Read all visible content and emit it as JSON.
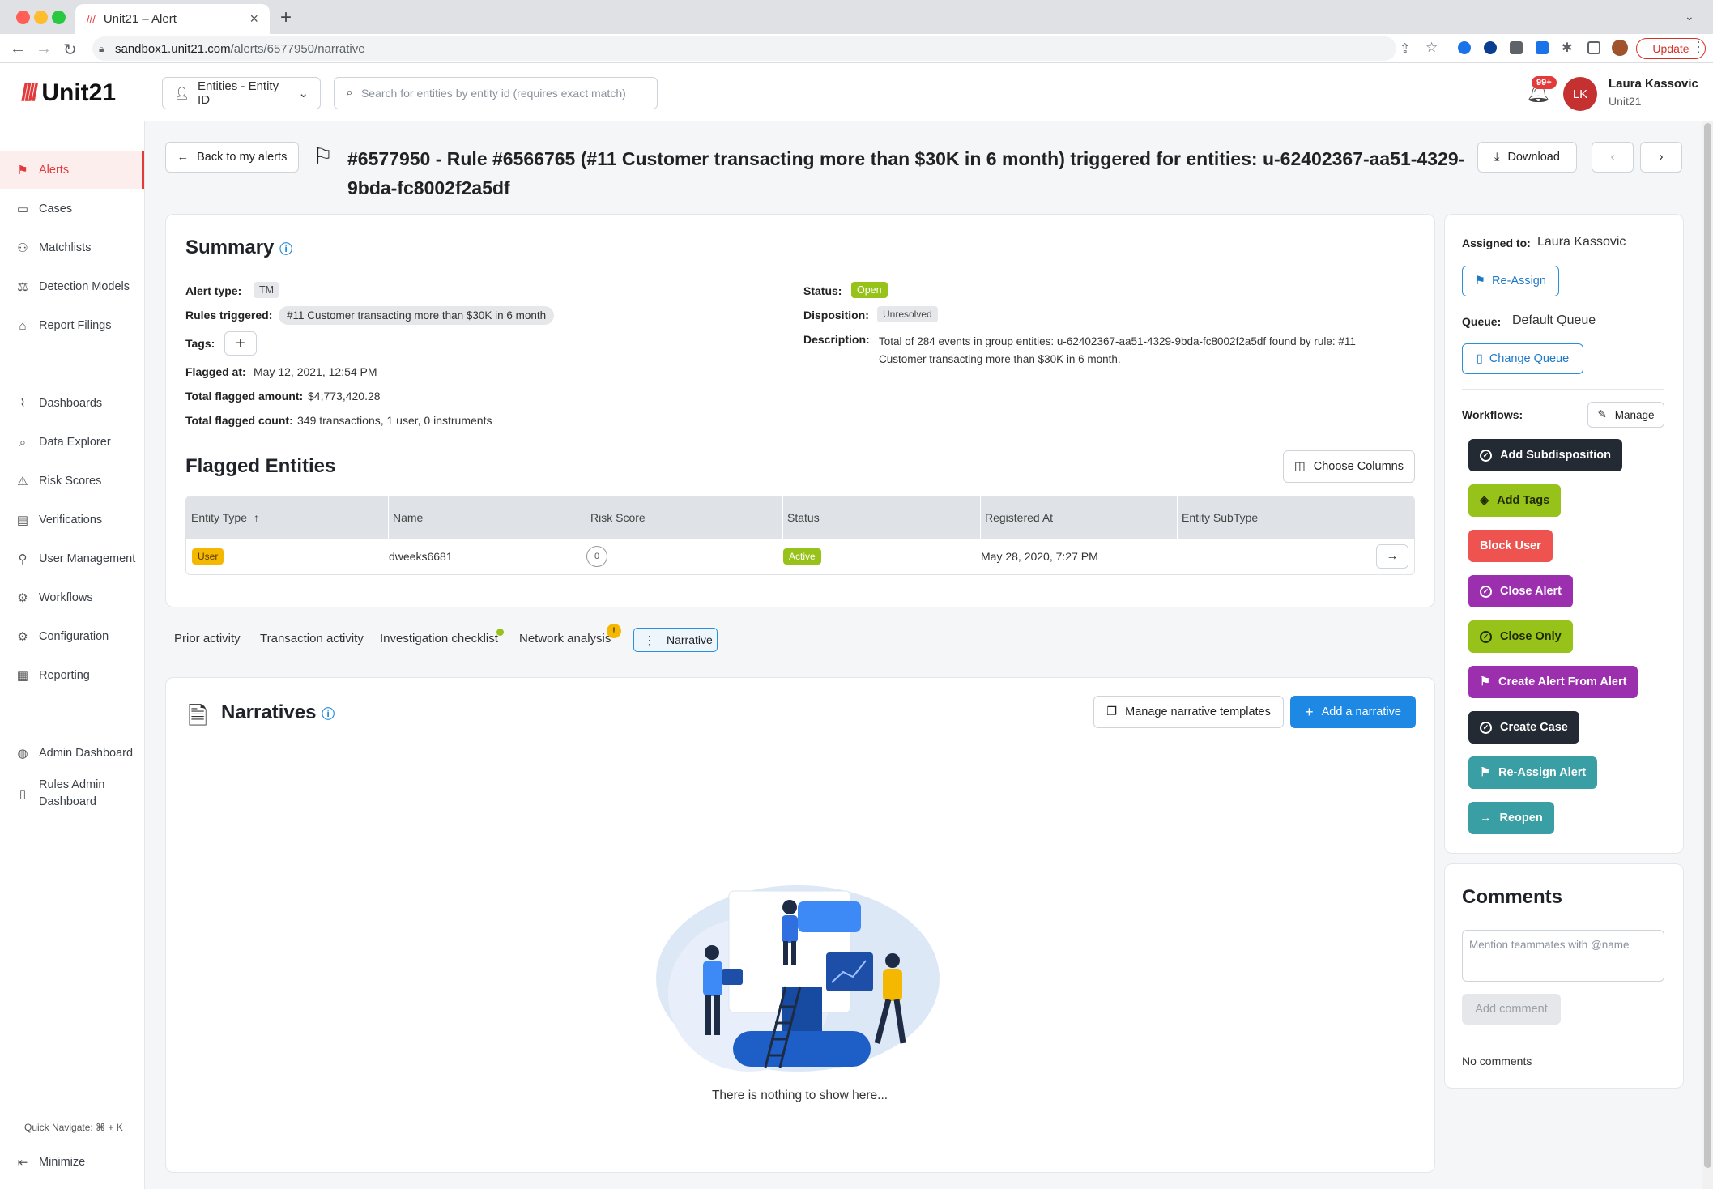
{
  "browser": {
    "tab_title": "Unit21 – Alert",
    "url_host": "sandbox1.unit21.com",
    "url_path": "/alerts/6577950/narrative",
    "update_label": "Update"
  },
  "header": {
    "logo_text": "Unit21",
    "entity_select": "Entities - Entity ID",
    "search_placeholder": "Search for entities by entity id (requires exact match)",
    "notif_count": "99+",
    "avatar_initials": "LK",
    "user_name": "Laura Kassovic",
    "user_org": "Unit21"
  },
  "sidebar": {
    "items": [
      {
        "label": "Alerts",
        "icon": "flag-icon"
      },
      {
        "label": "Cases",
        "icon": "briefcase-icon"
      },
      {
        "label": "Matchlists",
        "icon": "user-list-icon"
      },
      {
        "label": "Detection Models",
        "icon": "scale-icon"
      },
      {
        "label": "Report Filings",
        "icon": "bank-icon"
      },
      {
        "label": "Dashboards",
        "icon": "chart-line-icon"
      },
      {
        "label": "Data Explorer",
        "icon": "magnify-list-icon"
      },
      {
        "label": "Risk Scores",
        "icon": "warning-icon"
      },
      {
        "label": "Verifications",
        "icon": "id-card-icon"
      },
      {
        "label": "User Management",
        "icon": "user-icon"
      },
      {
        "label": "Workflows",
        "icon": "gear-flow-icon"
      },
      {
        "label": "Configuration",
        "icon": "gear-icon"
      },
      {
        "label": "Reporting",
        "icon": "report-icon"
      },
      {
        "label": "Admin Dashboard",
        "icon": "globe-icon"
      },
      {
        "label": "Rules Admin",
        "label2": "Dashboard",
        "icon": "clipboard-icon"
      }
    ],
    "quick_navigate": "Quick Navigate: ⌘ + K",
    "minimize": "Minimize"
  },
  "alert": {
    "back_label": "Back to my alerts",
    "title_line1": "#6577950 - Rule #6566765 (#11 Customer transacting more than $30K in 6 month) triggered for entities: u-62402367-aa51-4329-",
    "title_line2": "9bda-fc8002f2a5df",
    "download_label": "Download"
  },
  "summary": {
    "heading": "Summary",
    "alert_type_label": "Alert type:",
    "alert_type": "TM",
    "rules_label": "Rules triggered:",
    "rules": "#11 Customer transacting more than $30K in 6 month",
    "tags_label": "Tags:",
    "flagged_at_label": "Flagged at:",
    "flagged_at": "May 12, 2021, 12:54 PM",
    "amount_label": "Total flagged amount:",
    "amount": "$4,773,420.28",
    "count_label": "Total flagged count:",
    "count": "349 transactions, 1 user, 0 instruments",
    "status_label": "Status:",
    "status": "Open",
    "disposition_label": "Disposition:",
    "disposition": "Unresolved",
    "description_label": "Description:",
    "description_line1": "Total of 284 events in group entities: u-62402367-aa51-4329-9bda-fc8002f2a5df found by rule: #11",
    "description_line2": "Customer transacting more than $30K in 6 month."
  },
  "flagged": {
    "heading": "Flagged Entities",
    "choose_columns": "Choose Columns",
    "columns": [
      "Entity Type",
      "Name",
      "Risk Score",
      "Status",
      "Registered At",
      "Entity SubType"
    ],
    "row": {
      "type": "User",
      "name": "dweeks6681",
      "risk": "0",
      "status": "Active",
      "registered": "May 28, 2020, 7:27 PM",
      "subtype": ""
    }
  },
  "tabs": [
    "Prior activity",
    "Transaction activity",
    "Investigation checklist",
    "Network analysis",
    "Narrative"
  ],
  "narratives": {
    "heading": "Narratives",
    "manage_label": "Manage narrative templates",
    "add_label": "Add a narrative",
    "empty": "There is nothing to show here..."
  },
  "assign": {
    "assigned_label": "Assigned to:",
    "assigned_to": "Laura Kassovic",
    "reassign": "Re-Assign",
    "queue_label": "Queue:",
    "queue": "Default Queue",
    "change_queue": "Change Queue",
    "workflows_label": "Workflows:",
    "manage": "Manage",
    "workflows": [
      {
        "label": "Add Subdisposition",
        "color": "#232a33"
      },
      {
        "label": "Add Tags",
        "color": "#97c21a"
      },
      {
        "label": "Block User",
        "color": "#ef5350"
      },
      {
        "label": "Close Alert",
        "color": "#9c2fae"
      },
      {
        "label": "Close Only",
        "color": "#97c21a"
      },
      {
        "label": "Create Alert From Alert",
        "color": "#9c2fae"
      },
      {
        "label": "Create Case",
        "color": "#232a33"
      },
      {
        "label": "Re-Assign Alert",
        "color": "#3a9ea5"
      },
      {
        "label": "Reopen",
        "color": "#3a9ea5"
      }
    ]
  },
  "comments": {
    "heading": "Comments",
    "placeholder": "Mention teammates with @name",
    "add_label": "Add comment",
    "empty": "No comments"
  }
}
